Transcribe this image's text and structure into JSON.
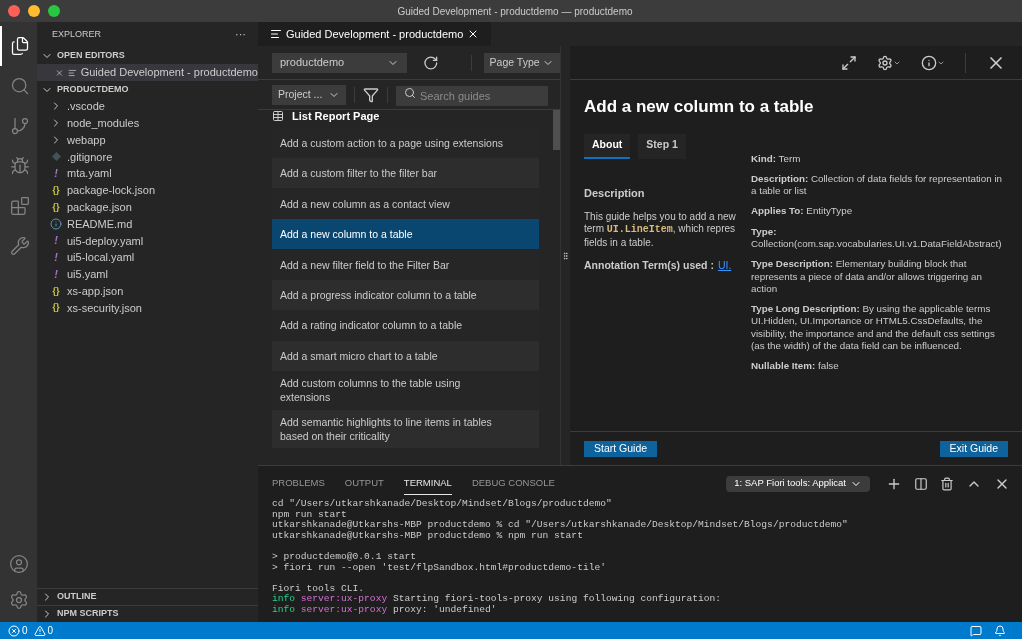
{
  "window": {
    "title": "Guided Development - productdemo — productdemo"
  },
  "activity_bar": {
    "top": [
      {
        "kind": "files",
        "selected": true
      },
      {
        "kind": "search",
        "selected": false
      },
      {
        "kind": "source",
        "selected": false
      },
      {
        "kind": "debug",
        "selected": false
      },
      {
        "kind": "extensions",
        "selected": false
      },
      {
        "kind": "tools",
        "selected": false
      }
    ]
  },
  "sidebar": {
    "title": "EXPLORER",
    "more": "···",
    "open_editors": {
      "label": "OPEN EDITORS",
      "expanded": true,
      "items": [
        {
          "name": "Guided Development - productdemo",
          "selected": true
        }
      ]
    },
    "project": {
      "label": "PRODUCTDEMO",
      "expanded": true,
      "items": [
        {
          "name": ".vscode",
          "kind": "folder",
          "expanded": false
        },
        {
          "name": "node_modules",
          "kind": "folder",
          "expanded": false
        },
        {
          "name": "webapp",
          "kind": "folder",
          "expanded": false
        },
        {
          "name": ".gitignore",
          "kind": "git"
        },
        {
          "name": "mta.yaml",
          "kind": "yaml",
          "icon": "!"
        },
        {
          "name": "package-lock.json",
          "kind": "json",
          "icon": "{}"
        },
        {
          "name": "package.json",
          "kind": "json",
          "icon": "{}"
        },
        {
          "name": "README.md",
          "kind": "md"
        },
        {
          "name": "ui5-deploy.yaml",
          "kind": "yaml",
          "icon": "!"
        },
        {
          "name": "ui5-local.yaml",
          "kind": "yaml",
          "icon": "!"
        },
        {
          "name": "ui5.yaml",
          "kind": "yaml",
          "icon": "!"
        },
        {
          "name": "xs-app.json",
          "kind": "json",
          "icon": "{}"
        },
        {
          "name": "xs-security.json",
          "kind": "json",
          "icon": "{}"
        }
      ]
    },
    "bottom_sections": [
      {
        "label": "OUTLINE",
        "expanded": false
      },
      {
        "label": "NPM SCRIPTS",
        "expanded": false
      }
    ]
  },
  "editor_tabs": [
    {
      "label": "Guided Development - productdemo",
      "selected": true
    }
  ],
  "guides": {
    "project_dropdown": "productdemo",
    "page_type_dropdown": "Page Type",
    "project_filter": "Project ...",
    "search": {
      "placeholder": "Search guides"
    },
    "group": "List Report Page",
    "items": [
      {
        "label": "Add a custom action to a page using extensions",
        "selected": false
      },
      {
        "label": "Add a custom filter to the filter bar",
        "selected": false
      },
      {
        "label": "Add a new column as a contact view",
        "selected": false
      },
      {
        "label": "Add a new column to a table",
        "selected": true
      },
      {
        "label": "Add a new filter field to the Filter Bar",
        "selected": false
      },
      {
        "label": "Add a progress indicator column to a table",
        "selected": false
      },
      {
        "label": "Add a rating indicator column to a table",
        "selected": false
      },
      {
        "label": "Add a smart micro chart to a table",
        "selected": false
      },
      {
        "label": "Add custom columns to the table using extensions",
        "selected": false
      },
      {
        "label": "Add semantic highlights to line items in tables based on their criticality",
        "selected": false
      }
    ]
  },
  "detail": {
    "title": "Add a new column to a table",
    "tabs": [
      {
        "label": "About",
        "selected": true
      },
      {
        "label": "Step 1",
        "selected": false
      }
    ],
    "description_heading": "Description",
    "description": {
      "line1": "This guide helps you to add a new",
      "before": "term",
      "code": "UI.LineItem",
      "after": ", which repres",
      "line3": "fields in a table."
    },
    "annotation_label": "Annotation Term(s) used :",
    "annotation_link": "UI.",
    "popup": [
      {
        "label": "Kind:",
        "value": "Term"
      },
      {
        "label": "Description:",
        "value": "Collection of data fields for representation in a table or list"
      },
      {
        "label": "Applies To:",
        "value": "EntityType"
      },
      {
        "label": "Type:",
        "value": "Collection(com.sap.vocabularies.UI.v1.DataFieldAbstract)"
      },
      {
        "label": "Type Description:",
        "value": "Elementary building block that represents a piece of data and/or allows triggering an action"
      },
      {
        "label": "Type Long Description:",
        "value": "By using the applicable terms UI.Hidden, UI.Importance or HTML5.CssDefaults, the visibility, the importance and and the default css settings (as the width) of the data field can be influenced."
      },
      {
        "label": "Nullable Item:",
        "value": "false"
      }
    ],
    "start_button": "Start Guide",
    "exit_button": "Exit Guide"
  },
  "panel": {
    "tabs": [
      {
        "label": "PROBLEMS",
        "selected": false
      },
      {
        "label": "OUTPUT",
        "selected": false
      },
      {
        "label": "TERMINAL",
        "selected": true
      },
      {
        "label": "DEBUG CONSOLE",
        "selected": false
      }
    ],
    "terminal_select": "1: SAP Fiori tools: Applicat",
    "lines": [
      {
        "gap_before": false,
        "segments": [
          {
            "kind": "plain",
            "text": "cd \"/Users/utkarshkanade/Desktop/Mindset/Blogs/productdemo\""
          }
        ]
      },
      {
        "gap_before": false,
        "segments": [
          {
            "kind": "plain",
            "text": "npm run start"
          }
        ]
      },
      {
        "gap_before": false,
        "segments": [
          {
            "kind": "plain",
            "text": "utkarshkanade@Utkarshs-MBP productdemo % cd \"/Users/utkarshkanade/Desktop/Mindset/Blogs/productdemo\""
          }
        ]
      },
      {
        "gap_before": false,
        "segments": [
          {
            "kind": "plain",
            "text": "utkarshkanade@Utkarshs-MBP productdemo % npm run start"
          }
        ]
      },
      {
        "gap_before": true,
        "segments": [
          {
            "kind": "plain",
            "text": "> productdemo@0.0.1 start"
          }
        ]
      },
      {
        "gap_before": false,
        "segments": [
          {
            "kind": "plain",
            "text": "> fiori run --open 'test/flpSandbox.html#productdemo-tile'"
          }
        ]
      },
      {
        "gap_before": true,
        "segments": [
          {
            "kind": "plain",
            "text": "Fiori tools CLI."
          }
        ]
      },
      {
        "gap_before": false,
        "segments": [
          {
            "kind": "level",
            "text": "info"
          },
          {
            "kind": "source",
            "text": "server:ux-proxy"
          },
          {
            "kind": "plain",
            "text": "Starting fiori-tools-proxy using following configuration:"
          }
        ]
      },
      {
        "gap_before": false,
        "segments": [
          {
            "kind": "level",
            "text": "info"
          },
          {
            "kind": "source",
            "text": "server:ux-proxy"
          },
          {
            "kind": "plain",
            "text": "proxy: 'undefined'"
          }
        ]
      }
    ]
  },
  "status_bar": {
    "errors": "0",
    "warnings": "0"
  }
}
